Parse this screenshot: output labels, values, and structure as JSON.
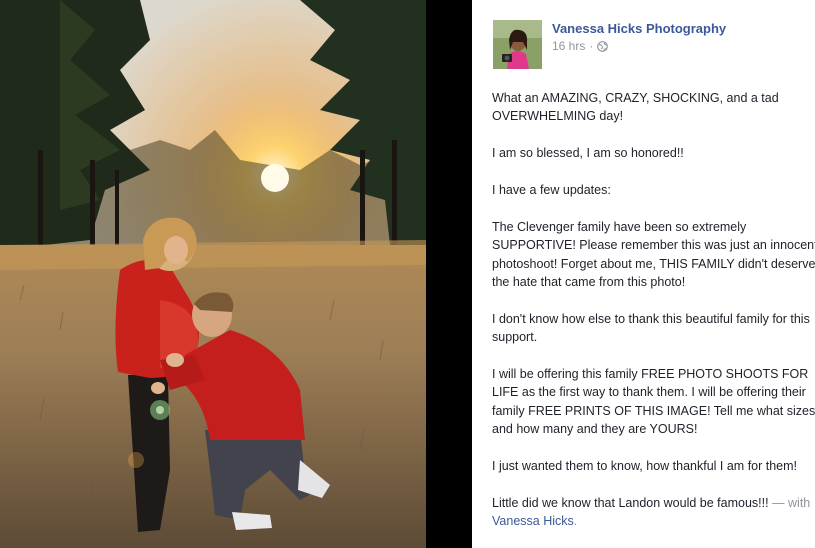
{
  "post": {
    "author": "Vanessa Hicks Photography",
    "timestamp": "16 hrs",
    "separator": "·",
    "privacy_icon": "globe-icon",
    "paragraphs": [
      "What an AMAZING, CRAZY, SHOCKING, and a tad OVERWHELMING day!",
      "I am so blessed, I am so honored!!",
      "I have a few updates:",
      "The Clevenger family have been so extremely SUPPORTIVE! Please remember this was just an innocent photoshoot! Forget about me, THIS FAMILY didn't deserve the hate that came from this photo!",
      "I don't know how else to thank this beautiful family for this support.",
      "I will be offering this family FREE PHOTO SHOOTS FOR LIFE as the first way to thank them. I will be offering their family FREE PRINTS OF THIS IMAGE! Tell me what sizes and how many and they are YOURS!",
      "I just wanted them to know, how thankful I am for them!"
    ],
    "closing": "Little did we know that Landon would be famous!!!",
    "tag_separator": "—",
    "tag_prefix": "with",
    "tag_name": "Vanessa Hicks",
    "tag_suffix": "."
  },
  "colors": {
    "link": "#3b5998",
    "meta": "#90949c",
    "text": "#1d2129",
    "spacer": "#000000"
  }
}
